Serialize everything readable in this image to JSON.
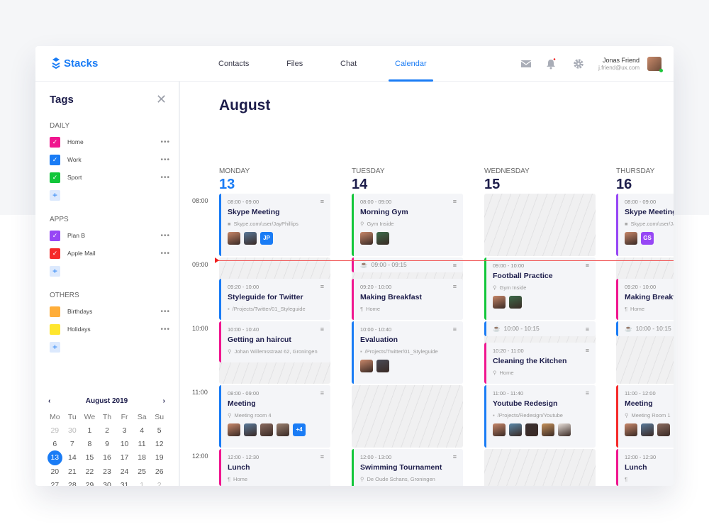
{
  "brand": {
    "name": "Stacks",
    "color": "#1a7cf5"
  },
  "nav": [
    {
      "label": "Contacts"
    },
    {
      "label": "Files"
    },
    {
      "label": "Chat"
    },
    {
      "label": "Calendar",
      "active": true
    }
  ],
  "header_icons": [
    "mail-icon",
    "bell-icon",
    "gear-icon"
  ],
  "user": {
    "name": "Jonas Friend",
    "email": "j.friend@ux.com",
    "status": "online"
  },
  "sidebar": {
    "title": "Tags",
    "groups": [
      {
        "label": "DAILY",
        "tags": [
          {
            "label": "Home",
            "color": "#f0168f",
            "checked": true
          },
          {
            "label": "Work",
            "color": "#1a7cf5",
            "checked": true
          },
          {
            "label": "Sport",
            "color": "#12c63a",
            "checked": true
          }
        ]
      },
      {
        "label": "APPS",
        "tags": [
          {
            "label": "Plan B",
            "color": "#9747f5",
            "checked": true
          },
          {
            "label": "Apple Mail",
            "color": "#f52a2a",
            "checked": true
          }
        ]
      },
      {
        "label": "OTHERS",
        "tags": [
          {
            "label": "Birthdays",
            "color": "#ffae3a",
            "checked": false
          },
          {
            "label": "Holidays",
            "color": "#ffe62e",
            "checked": false
          }
        ]
      }
    ],
    "add_label": "+",
    "more_label": "•••",
    "mini_calendar": {
      "title": "August 2019",
      "prev": "‹",
      "next": "›",
      "weekdays": [
        "Mo",
        "Tu",
        "We",
        "Th",
        "Fr",
        "Sa",
        "Su"
      ],
      "days": [
        [
          "29",
          true
        ],
        [
          "30",
          true
        ],
        [
          "1"
        ],
        [
          "2"
        ],
        [
          "3"
        ],
        [
          "4"
        ],
        [
          "5"
        ],
        [
          "6"
        ],
        [
          "7"
        ],
        [
          "8"
        ],
        [
          "9"
        ],
        [
          "10"
        ],
        [
          "11"
        ],
        [
          "12"
        ],
        [
          "13",
          false,
          true
        ],
        [
          "14"
        ],
        [
          "15"
        ],
        [
          "16"
        ],
        [
          "17"
        ],
        [
          "18"
        ],
        [
          "19"
        ],
        [
          "20"
        ],
        [
          "21"
        ],
        [
          "22"
        ],
        [
          "23"
        ],
        [
          "24"
        ],
        [
          "25"
        ],
        [
          "26"
        ],
        [
          "27"
        ],
        [
          "28"
        ],
        [
          "29"
        ],
        [
          "30"
        ],
        [
          "31"
        ],
        [
          "1",
          true
        ],
        [
          "2",
          true
        ]
      ]
    }
  },
  "calendar": {
    "month": "August",
    "times": [
      "08:00",
      "09:00",
      "10:00",
      "11:00",
      "12:00"
    ],
    "current_time": "09:00",
    "days": [
      {
        "name": "MONDAY",
        "num": "13",
        "today": true,
        "events": [
          {
            "start": "08:00",
            "end": "09:00",
            "time": "08:00 - 09:00",
            "title": "Skype Meeting",
            "loc": "Skype.com/user/JayPhillips",
            "loc_icon": "video-icon",
            "color": "#1a7cf5",
            "att": [
              "p1",
              "p2",
              {
                "t": "JP",
                "c": "#1a7cf5"
              }
            ]
          },
          {
            "start": "09:20",
            "end": "10:00",
            "time": "09:20 - 10:00",
            "title": "Styleguide for Twitter",
            "loc": "/Projects/Twitter/01_Styleguide",
            "loc_icon": "comment-icon",
            "color": "#1a7cf5",
            "att": []
          },
          {
            "start": "10:00",
            "end": "10:40",
            "time": "10:00 - 10:40",
            "title": "Getting an haircut",
            "loc": "Johan Willemsstraat 62, Groningen",
            "loc_icon": "pin-icon",
            "color": "#f0168f",
            "att": []
          },
          {
            "start": "11:00",
            "end": "12:00",
            "time": "08:00 - 09:00",
            "title": "Meeting",
            "loc": "Meeting room 4",
            "loc_icon": "pin-icon",
            "color": "#1a7cf5",
            "att": [
              "p1",
              "p2",
              "p3",
              "p4",
              {
                "t": "+4",
                "c": "#1a7cf5"
              }
            ]
          },
          {
            "start": "12:00",
            "end": "12:36",
            "time": "12:00 - 12:30",
            "title": "Lunch",
            "loc": "Home",
            "loc_icon": "cutlery-icon",
            "color": "#f0168f",
            "att": []
          }
        ]
      },
      {
        "name": "TUESDAY",
        "num": "14",
        "events": [
          {
            "start": "08:00",
            "end": "09:00",
            "time": "08:00 - 09:00",
            "title": "Morning Gym",
            "loc": "Gym Inside",
            "loc_icon": "pin-icon",
            "color": "#12c63a",
            "att": [
              "p1",
              "p5"
            ]
          },
          {
            "start": "09:00",
            "end": "09:15",
            "time": "09:00 - 09:15",
            "short": true,
            "color": "#f0168f"
          },
          {
            "start": "09:20",
            "end": "10:00",
            "time": "09:20 - 10:00",
            "title": "Making Breakfast",
            "loc": "Home",
            "loc_icon": "cutlery-icon",
            "color": "#f0168f",
            "att": []
          },
          {
            "start": "10:00",
            "end": "11:00",
            "time": "10:00 - 10:40",
            "title": "Evaluation",
            "loc": "/Projects/Twitter/01_Styleguide",
            "loc_icon": "comment-icon",
            "color": "#1a7cf5",
            "att": [
              "p1",
              "p6"
            ]
          },
          {
            "start": "12:00",
            "end": "13:00",
            "time": "12:00 - 13:00",
            "title": "Swimming Tournament",
            "loc": "De Oude Schans, Groningen",
            "loc_icon": "pin-icon",
            "color": "#12c63a",
            "att": [
              "p1",
              "p5"
            ]
          }
        ]
      },
      {
        "name": "WEDNESDAY",
        "num": "15",
        "events": [
          {
            "start": "09:00",
            "end": "10:00",
            "time": "09:00 - 10:00",
            "title": "Football Practice",
            "loc": "Gym Inside",
            "loc_icon": "pin-icon",
            "color": "#12c63a",
            "att": [
              "p1",
              "p5"
            ]
          },
          {
            "start": "10:00",
            "end": "10:15",
            "time": "10:00 - 10:15",
            "short": true,
            "color": "#1a7cf5"
          },
          {
            "start": "10:20",
            "end": "11:00",
            "time": "10:20 - 11:00",
            "title": "Cleaning the Kitchen",
            "loc": "Home",
            "loc_icon": "pin-icon",
            "color": "#f0168f",
            "att": []
          },
          {
            "start": "11:00",
            "end": "12:00",
            "time": "11:00 - 11:40",
            "title": "Youtube Redesign",
            "loc": "/Projects/Redesign/Youtube",
            "loc_icon": "comment-icon",
            "color": "#1a7cf5",
            "att": [
              "p1",
              "p7",
              "p8",
              "p9",
              "p10"
            ]
          }
        ]
      },
      {
        "name": "THURSDAY",
        "num": "16",
        "events": [
          {
            "start": "08:00",
            "end": "09:00",
            "time": "08:00 - 09:00",
            "title": "Skype Meeting",
            "loc": "Skype.com/user/JayPhillips",
            "loc_icon": "video-icon",
            "color": "#9747f5",
            "att": [
              "p1",
              {
                "t": "GS",
                "c": "#9747f5"
              }
            ]
          },
          {
            "start": "09:20",
            "end": "10:00",
            "time": "09:20 - 10:00",
            "title": "Making Breakfast",
            "loc": "Home",
            "loc_icon": "cutlery-icon",
            "color": "#f0168f",
            "att": []
          },
          {
            "start": "10:00",
            "end": "10:15",
            "time": "10:00 - 10:15",
            "short": true,
            "color": "#1a7cf5"
          },
          {
            "start": "11:00",
            "end": "12:00",
            "time": "11:00 - 12:00",
            "title": "Meeting",
            "loc": "Meeting Room 1",
            "loc_icon": "pin-icon",
            "color": "#f52a2a",
            "att": [
              "p1",
              "p2",
              "p3"
            ]
          },
          {
            "start": "12:00",
            "end": "12:36",
            "time": "12:00 - 12:30",
            "title": "Lunch",
            "loc": "",
            "loc_icon": "cutlery-icon",
            "color": "#f0168f",
            "att": []
          }
        ]
      }
    ]
  }
}
